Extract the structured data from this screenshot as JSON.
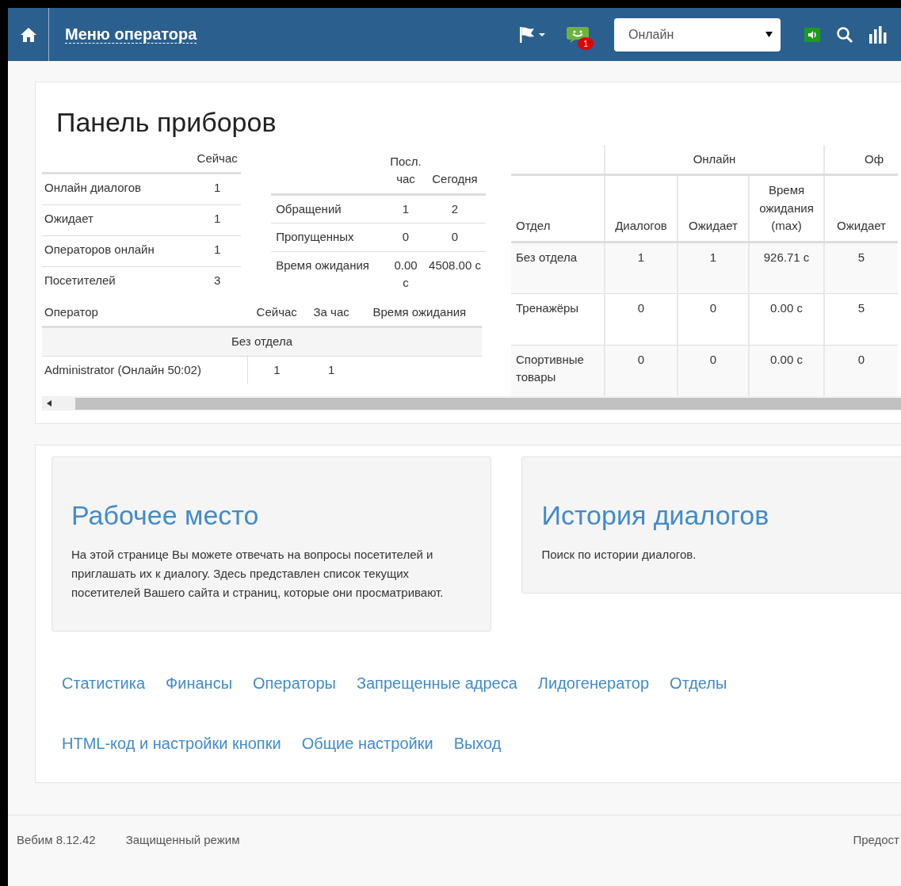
{
  "navbar": {
    "title": "Меню оператора",
    "chat_badge": "1",
    "status_select": {
      "value": "Онлайн"
    }
  },
  "dashboard": {
    "title": "Панель приборов",
    "summary": {
      "columns": [
        "Сейчас"
      ],
      "rows": [
        {
          "label": "Онлайн диалогов",
          "value": "1"
        },
        {
          "label": "Ожидает",
          "value": "1"
        },
        {
          "label": "Операторов онлайн",
          "value": "1"
        },
        {
          "label": "Посетителей",
          "value": "3"
        }
      ]
    },
    "periods": {
      "columns": [
        "Посл. час",
        "Сегодня"
      ],
      "rows": [
        {
          "label": "Обращений",
          "values": [
            "1",
            "2"
          ]
        },
        {
          "label": "Пропущенных",
          "values": [
            "0",
            "0"
          ]
        },
        {
          "label": "Время ожидания",
          "values": [
            "0.00 с",
            "4508.00 с"
          ]
        }
      ]
    },
    "operators": {
      "columns": [
        "Оператор",
        "Сейчас",
        "За час",
        "Время ожидания"
      ],
      "groups": [
        {
          "name": "Без отдела",
          "rows": [
            {
              "name": "Administrator (Онлайн 50:02)",
              "values": [
                "1",
                "1"
              ]
            }
          ]
        }
      ]
    },
    "departments": {
      "group_headers": [
        "Онлайн",
        "Оф"
      ],
      "columns": [
        "Отдел",
        "Диалогов",
        "Ожидает",
        "Время ожидания (max)",
        "Ожидает"
      ],
      "rows": [
        {
          "cells": [
            "Без отдела",
            "1",
            "1",
            "926.71 с",
            "5"
          ]
        },
        {
          "cells": [
            "Тренажёры",
            "0",
            "0",
            "0.00 с",
            "5"
          ]
        },
        {
          "cells": [
            "Спортивные товары",
            "0",
            "0",
            "0.00 с",
            "0"
          ]
        }
      ]
    }
  },
  "cards": [
    {
      "title": "Рабочее место",
      "text": "На этой странице Вы можете отвечать на вопросы посетителей и приглашать их к диалогу. Здесь представлен список текущих посетителей Вашего сайта и страниц, которые они просматривают."
    },
    {
      "title": "История диалогов",
      "text": "Поиск по истории диалогов."
    }
  ],
  "links": [
    [
      "Статистика",
      "Финансы",
      "Операторы",
      "Запрещенные адреса",
      "Лидогенератор",
      "Отделы"
    ],
    [
      "HTML-код и настройки кнопки",
      "Общие настройки",
      "Выход"
    ]
  ],
  "footer": {
    "version": "Вебим 8.12.42",
    "mode": "Защищенный режим",
    "right": "Предост"
  }
}
